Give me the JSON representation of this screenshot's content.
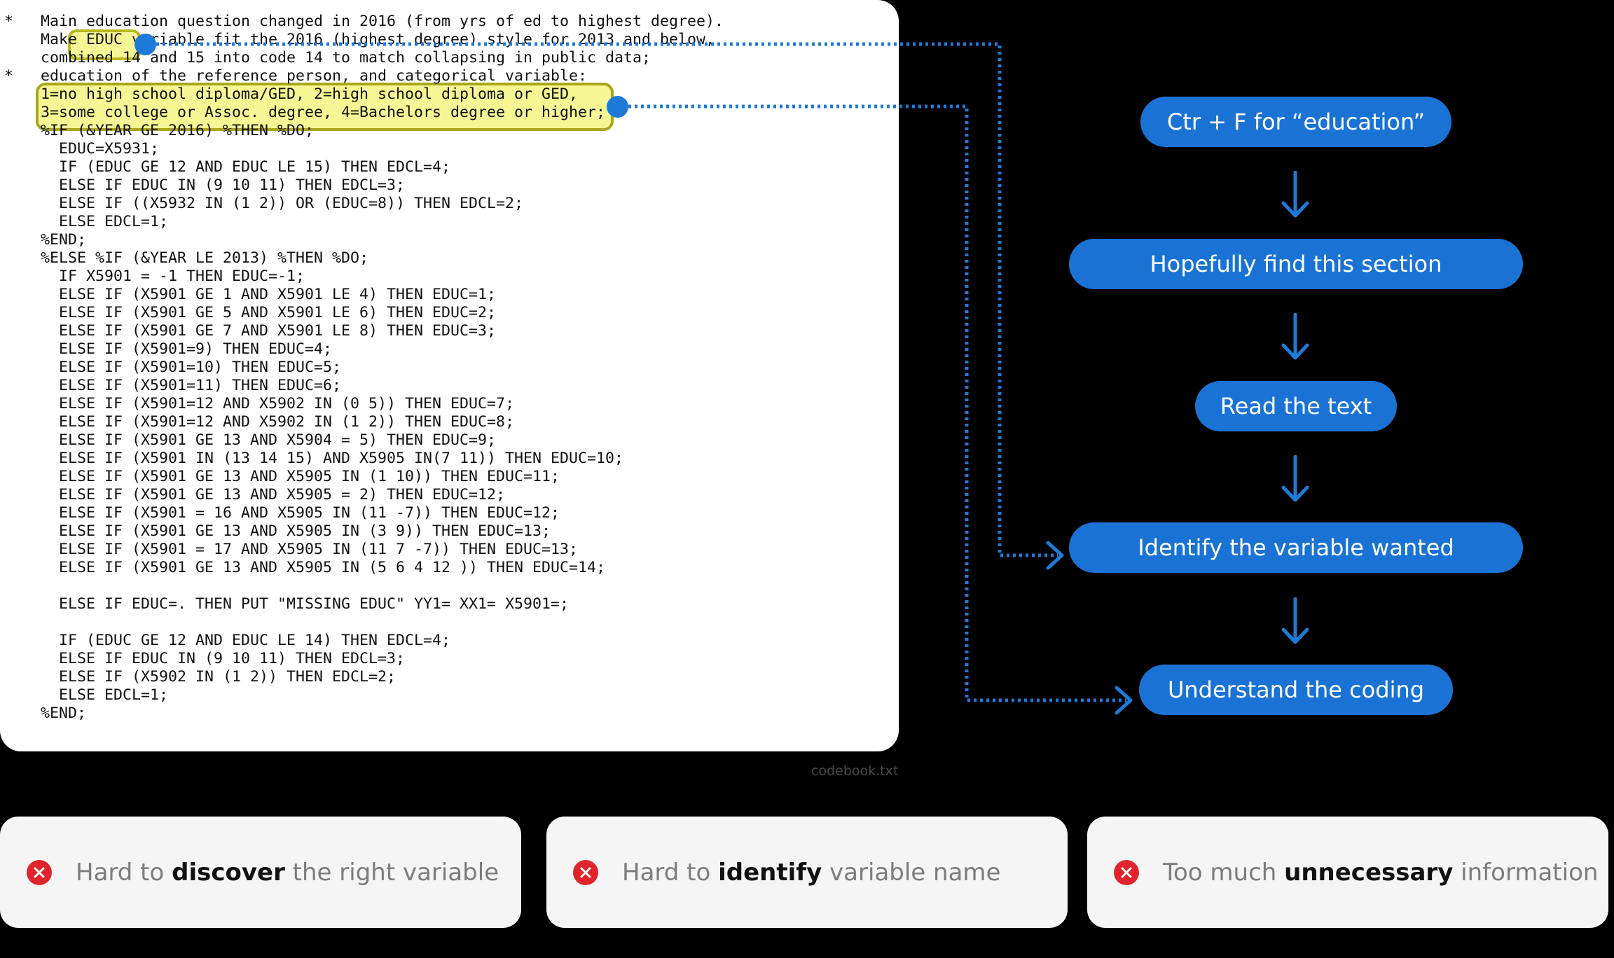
{
  "code": {
    "lines": [
      "*   Main education question changed in 2016 (from yrs of ed to highest degree).",
      "    Make EDUC variable fit the 2016 (highest degree) style for 2013 and below,",
      "    combined 14 and 15 into code 14 to match collapsing in public data;",
      "*   education of the reference person, and categorical variable:",
      "    1=no high school diploma/GED, 2=high school diploma or GED,",
      "    3=some college or Assoc. degree, 4=Bachelors degree or higher;",
      "    %IF (&YEAR GE 2016) %THEN %DO;",
      "      EDUC=X5931;",
      "      IF (EDUC GE 12 AND EDUC LE 15) THEN EDCL=4;",
      "      ELSE IF EDUC IN (9 10 11) THEN EDCL=3;",
      "      ELSE IF ((X5932 IN (1 2)) OR (EDUC=8)) THEN EDCL=2;",
      "      ELSE EDCL=1;",
      "    %END;",
      "    %ELSE %IF (&YEAR LE 2013) %THEN %DO;",
      "      IF X5901 = -1 THEN EDUC=-1;",
      "      ELSE IF (X5901 GE 1 AND X5901 LE 4) THEN EDUC=1;",
      "      ELSE IF (X5901 GE 5 AND X5901 LE 6) THEN EDUC=2;",
      "      ELSE IF (X5901 GE 7 AND X5901 LE 8) THEN EDUC=3;",
      "      ELSE IF (X5901=9) THEN EDUC=4;",
      "      ELSE IF (X5901=10) THEN EDUC=5;",
      "      ELSE IF (X5901=11) THEN EDUC=6;",
      "      ELSE IF (X5901=12 AND X5902 IN (0 5)) THEN EDUC=7;",
      "      ELSE IF (X5901=12 AND X5902 IN (1 2)) THEN EDUC=8;",
      "      ELSE IF (X5901 GE 13 AND X5904 = 5) THEN EDUC=9;",
      "      ELSE IF (X5901 IN (13 14 15) AND X5905 IN(7 11)) THEN EDUC=10;",
      "      ELSE IF (X5901 GE 13 AND X5905 IN (1 10)) THEN EDUC=11;",
      "      ELSE IF (X5901 GE 13 AND X5905 = 2) THEN EDUC=12;",
      "      ELSE IF (X5901 = 16 AND X5905 IN (11 -7)) THEN EDUC=12;",
      "      ELSE IF (X5901 GE 13 AND X5905 IN (3 9)) THEN EDUC=13;",
      "      ELSE IF (X5901 = 17 AND X5905 IN (11 7 -7)) THEN EDUC=13;",
      "      ELSE IF (X5901 GE 13 AND X5905 IN (5 6 4 12 )) THEN EDUC=14;",
      "",
      "      ELSE IF EDUC=. THEN PUT \"MISSING EDUC\" YY1= XX1= X5901=;",
      "",
      "      IF (EDUC GE 12 AND EDUC LE 14) THEN EDCL=4;",
      "      ELSE IF EDUC IN (9 10 11) THEN EDCL=3;",
      "      ELSE IF (X5902 IN (1 2)) THEN EDCL=2;",
      "      ELSE EDCL=1;",
      "    %END;"
    ],
    "filename": "codebook.txt"
  },
  "flow": {
    "steps": [
      "Ctr + F for “education”",
      "Hopefully find this section",
      "Read the text",
      "Identify the variable wanted",
      "Understand the coding"
    ],
    "color": "#1a73d4"
  },
  "problems": [
    {
      "pre": "Hard to ",
      "bold": "discover",
      "post": " the right variable"
    },
    {
      "pre": "Hard to ",
      "bold": "identify",
      "post": " variable name"
    },
    {
      "pre": "Too much ",
      "bold": "unnecessary",
      "post": " information"
    }
  ],
  "colors": {
    "error": "#e0242b",
    "highlight": "#eeee3c"
  }
}
